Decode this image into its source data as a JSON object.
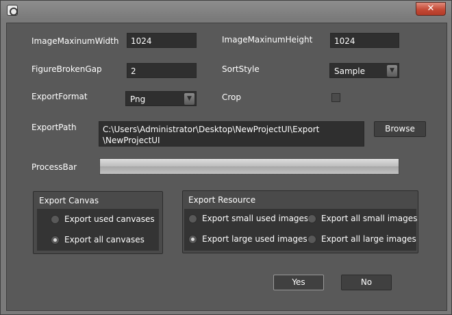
{
  "titlebar": {
    "close_label": "✕"
  },
  "form": {
    "image_max_width_label": "ImageMaxinumWidth",
    "image_max_width_value": "1024",
    "image_max_height_label": "ImageMaxinumHeight",
    "image_max_height_value": "1024",
    "figure_broken_gap_label": "FigureBrokenGap",
    "figure_broken_gap_value": "2",
    "sort_style_label": "SortStyle",
    "sort_style_value": "Sample",
    "export_format_label": "ExportFormat",
    "export_format_value": "Png",
    "crop_label": "Crop",
    "crop_checked": false,
    "export_path_label": "ExportPath",
    "export_path_line1": "C:\\Users\\Administrator\\Desktop\\NewProjectUI\\Export",
    "export_path_line2": "\\NewProjectUI",
    "browse_label": "Browse",
    "process_bar_label": "ProcessBar",
    "process_progress_percent": 0
  },
  "export_canvas": {
    "title": "Export Canvas",
    "options": [
      {
        "label": "Export used canvases",
        "checked": false
      },
      {
        "label": "Export all canvases",
        "checked": true
      }
    ]
  },
  "export_resource": {
    "title": "Export Resource",
    "options": [
      {
        "label": "Export small used images",
        "checked": false
      },
      {
        "label": "Export all small images",
        "checked": false
      },
      {
        "label": "Export large used images",
        "checked": true
      },
      {
        "label": "Export all large images",
        "checked": false
      }
    ]
  },
  "footer": {
    "yes_label": "Yes",
    "no_label": "No"
  },
  "icons": {
    "app": "app-icon",
    "close": "close-icon",
    "dropdown": "chevron-down-icon"
  }
}
